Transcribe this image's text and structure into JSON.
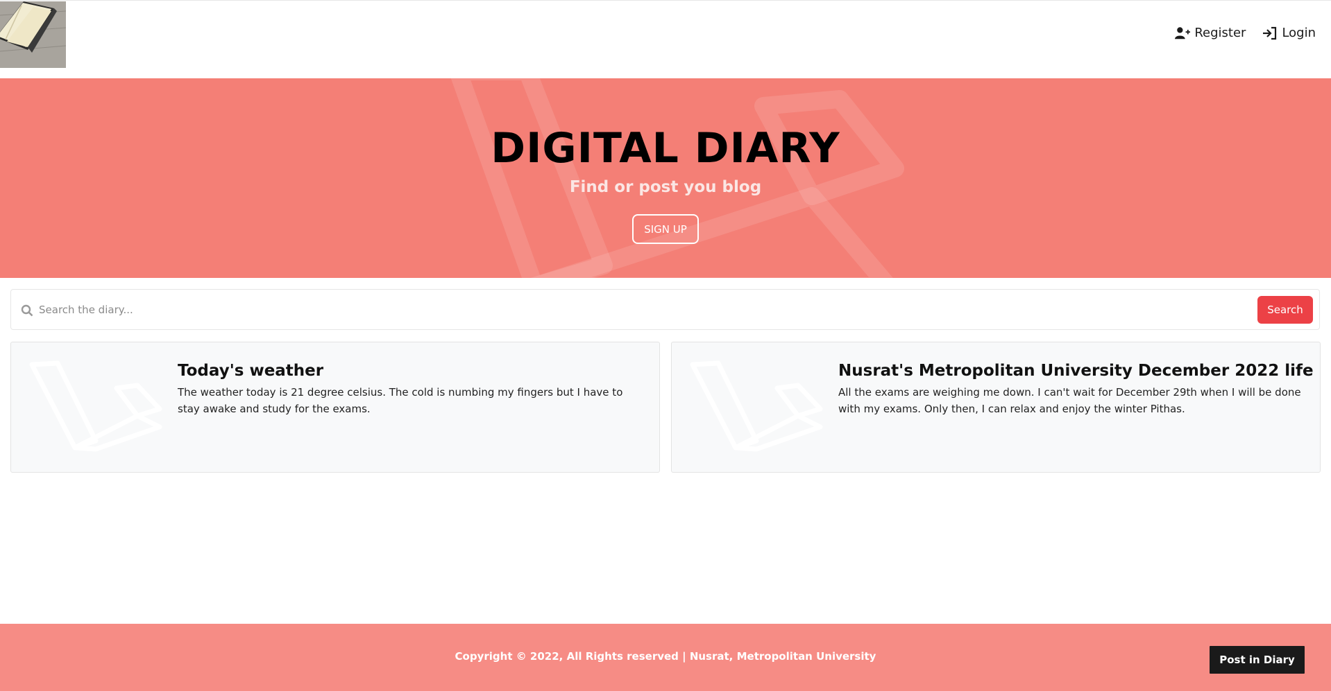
{
  "nav": {
    "logo_icon": "open-notebook-photo",
    "links": [
      {
        "label": "Register",
        "icon": "user-plus-icon"
      },
      {
        "label": "Login",
        "icon": "sign-in-icon"
      }
    ]
  },
  "hero": {
    "title": "DIGITAL DIARY",
    "subtitle": "Find or post you blog",
    "signup_label": "SIGN UP",
    "background_color": "#f47f76"
  },
  "search": {
    "placeholder": "Search the diary...",
    "value": "",
    "button_label": "Search",
    "button_color": "#ec4146"
  },
  "posts": [
    {
      "title": "Today's weather",
      "body": "The weather today is 21 degree celsius. The cold is numbing my fingers but I have to stay awake and study for the exams."
    },
    {
      "title": "Nusrat's Metropolitan University December 2022 life",
      "body": "All the exams are weighing me down. I can't wait for December 29th when I will be done with my exams. Only then, I can relax and enjoy the winter Pithas."
    }
  ],
  "footer": {
    "copyright": "Copyright © 2022, All Rights reserved | Nusrat, Metropolitan University",
    "post_button_label": "Post in Diary",
    "background_color": "#f68c85"
  }
}
